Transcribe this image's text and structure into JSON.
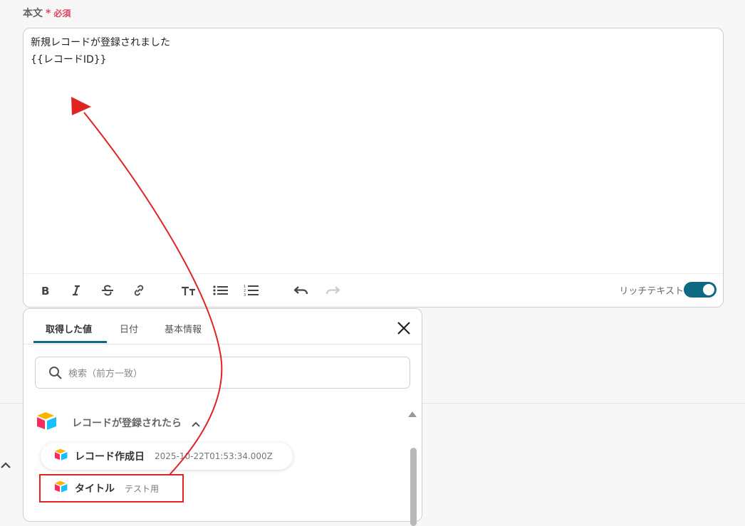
{
  "field": {
    "label": "本文",
    "required_star": "*",
    "required_text": "必須"
  },
  "editor": {
    "lines": [
      "新規レコードが登録されました",
      "{{レコードID}}"
    ],
    "toolbar_icons": [
      "bold-icon",
      "italic-icon",
      "strikethrough-icon",
      "link-icon",
      "text-size-icon",
      "bullet-list-icon",
      "numbered-list-icon",
      "undo-icon",
      "redo-icon"
    ],
    "rich_text_label": "リッチテキスト",
    "rich_text_enabled": true
  },
  "popup": {
    "tabs": [
      {
        "label": "取得した値",
        "active": true
      },
      {
        "label": "日付",
        "active": false
      },
      {
        "label": "基本情報",
        "active": false
      }
    ],
    "search": {
      "placeholder": "検索（前方一致）",
      "value": ""
    },
    "group": {
      "label": "レコードが登録されたら",
      "icon": "airtable-icon",
      "expanded": true
    },
    "items": [
      {
        "name": "レコード作成日",
        "value": "2025-10-22T01:53:34.000Z",
        "icon": "airtable-icon"
      },
      {
        "name": "タイトル",
        "value": "テスト用",
        "icon": "airtable-icon",
        "highlighted": true
      }
    ]
  },
  "colors": {
    "accent": "#0d6a82",
    "required": "#e0425f",
    "annotation": "#e02424"
  }
}
